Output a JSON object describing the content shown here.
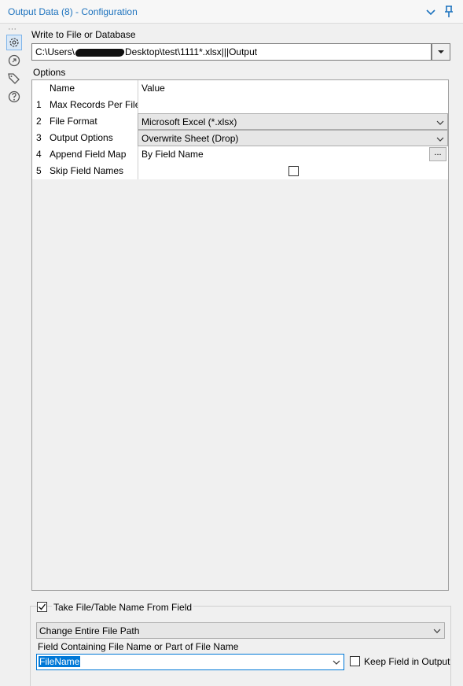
{
  "header": {
    "title": "Output Data (8) - Configuration"
  },
  "sidebar": {
    "dots": "···"
  },
  "write_to": {
    "label": "Write to File or Database",
    "path_prefix": "C:\\Users\\",
    "path_suffix": "Desktop\\test\\1111*.xlsx|||Output"
  },
  "options": {
    "label": "Options",
    "columns": {
      "name": "Name",
      "value": "Value"
    },
    "rows": [
      {
        "num": "1",
        "name": "Max Records Per File",
        "value": ""
      },
      {
        "num": "2",
        "name": "File Format",
        "value": "Microsoft Excel (*.xlsx)"
      },
      {
        "num": "3",
        "name": "Output Options",
        "value": "Overwrite Sheet (Drop)"
      },
      {
        "num": "4",
        "name": "Append Field Map",
        "value": "By Field Name",
        "button": "..."
      },
      {
        "num": "5",
        "name": "Skip Field Names",
        "value": ""
      }
    ]
  },
  "take_name": {
    "label": "Take File/Table Name From Field",
    "checked": true,
    "mode_value": "Change Entire File Path",
    "field_label": "Field Containing File Name or Part of File Name",
    "field_value": "FileName",
    "keep_label": "Keep Field in Output",
    "keep_checked": false
  },
  "colors": {
    "accent": "#1e73be",
    "selection": "#0078d7"
  }
}
